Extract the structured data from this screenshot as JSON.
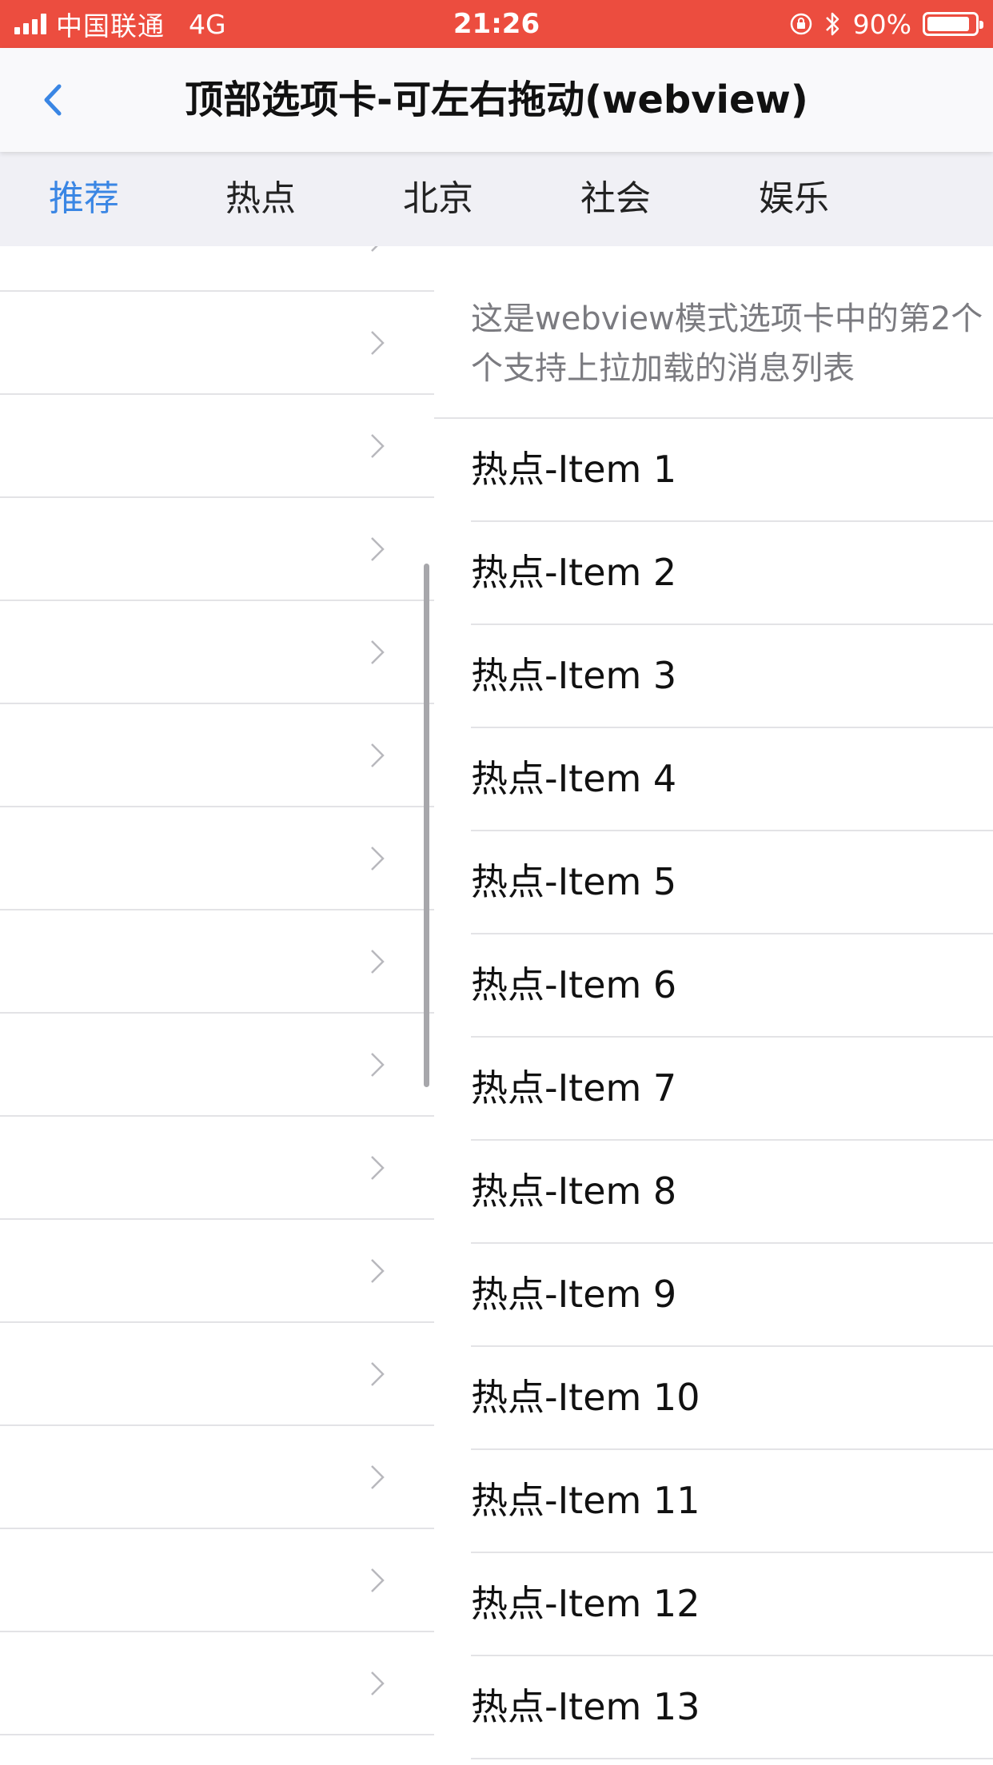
{
  "status_bar": {
    "carrier": "中国联通",
    "network": "4G",
    "time": "21:26",
    "battery_percent": "90%",
    "battery_level": 0.9,
    "background_color": "#ec4d3f"
  },
  "nav_bar": {
    "back_icon": "chevron-left-icon",
    "title": "顶部选项卡-可左右拖动(webview)",
    "accent_color": "#3a86e4"
  },
  "tabs": [
    {
      "label": "推荐",
      "active": true
    },
    {
      "label": "热点",
      "active": false
    },
    {
      "label": "北京",
      "active": false
    },
    {
      "label": "社会",
      "active": false
    },
    {
      "label": "娱乐",
      "active": false
    }
  ],
  "left_panel": {
    "row_icon": "chevron-right-icon"
  },
  "right_panel": {
    "intro_line1": "这是webview模式选项卡中的第2个",
    "intro_line2": "个支持上拉加载的消息列表",
    "items": [
      "热点-Item 1",
      "热点-Item 2",
      "热点-Item 3",
      "热点-Item 4",
      "热点-Item 5",
      "热点-Item 6",
      "热点-Item 7",
      "热点-Item 8",
      "热点-Item 9",
      "热点-Item 10",
      "热点-Item 11",
      "热点-Item 12",
      "热点-Item 13"
    ]
  }
}
